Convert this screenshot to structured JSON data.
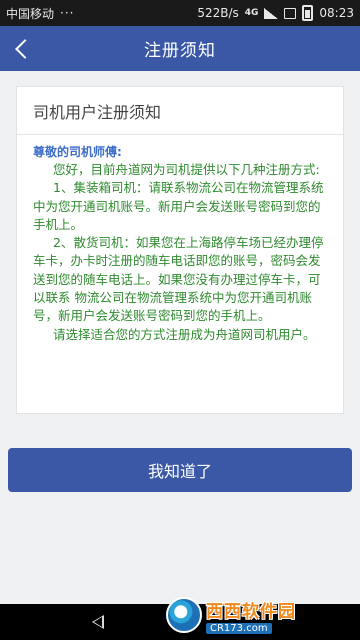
{
  "status_bar": {
    "carrier": "中国移动",
    "dots": "···",
    "speed": "522B/s",
    "network": "4G",
    "time": "08:23"
  },
  "nav": {
    "title": "注册须知",
    "back_icon": "chevron-left-icon"
  },
  "card": {
    "title": "司机用户注册须知",
    "greeting": "尊敬的司机师傅:",
    "paragraphs": [
      "您好，目前舟道网为司机提供以下几种注册方式:",
      "1、集装箱司机：请联系物流公司在物流管理系统中为您开通司机账号。新用户会发送账号密码到您的手机上。",
      "2、散货司机：如果您在上海路停车场已经办理停车卡，办卡时注册的随车电话即您的账号，密码会发送到您的随车电话上。如果您没有办理过停车卡，可以联系 物流公司在物流管理系统中为您开通司机账号，新用户会发送账号密码到您的手机上。",
      "请选择适合您的方式注册成为舟道网司机用户。"
    ]
  },
  "confirm_button": "我知道了",
  "watermark": {
    "main": "西西软件园",
    "sub": "CR173.com"
  },
  "colors": {
    "primary": "#3a58a5",
    "greeting": "#3d6ec9",
    "body_text": "#2f8a2f",
    "background": "#eef0f2"
  }
}
